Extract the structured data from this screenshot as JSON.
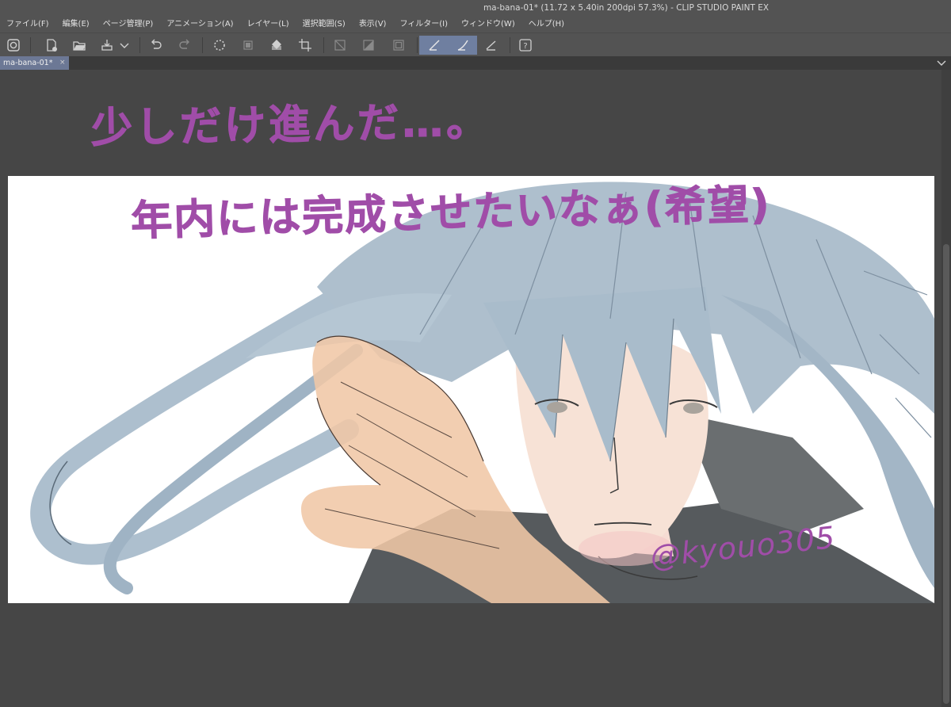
{
  "window": {
    "title": "ma-bana-01* (11.72 x 5.40in 200dpi 57.3%)  - CLIP STUDIO PAINT EX"
  },
  "menu": [
    "ファイル(F)",
    "編集(E)",
    "ページ管理(P)",
    "アニメーション(A)",
    "レイヤー(L)",
    "選択範囲(S)",
    "表示(V)",
    "フィルター(I)",
    "ウィンドウ(W)",
    "ヘルプ(H)"
  ],
  "toolbar": {
    "buttons": [
      "clip-studio-icon",
      "new-file-icon",
      "open-file-icon",
      "save-icon",
      "dropdown-arrow-icon",
      "undo-icon",
      "redo-icon",
      "loading-icon",
      "transform-icon",
      "fill-icon",
      "crop-icon",
      "grid-icon",
      "gradient-icon",
      "frame-icon",
      "ruler-snap-icon",
      "special-ruler-snap-icon",
      "perspective-ruler-icon",
      "help-icon"
    ]
  },
  "tabs": [
    {
      "label": "ma-bana-01*",
      "close": "×"
    }
  ],
  "canvas": {
    "handwriting_line1": "少しだけ進んだ…。",
    "handwriting_line2": "年内には完成させたいなぁ(希望)",
    "signature": "@kyouo305"
  },
  "colors": {
    "ui_background": "#535353",
    "canvas_background": "#464646",
    "active_tab": "#6c7895",
    "handwriting": "#a04da8",
    "hair": "#a9bccb"
  }
}
